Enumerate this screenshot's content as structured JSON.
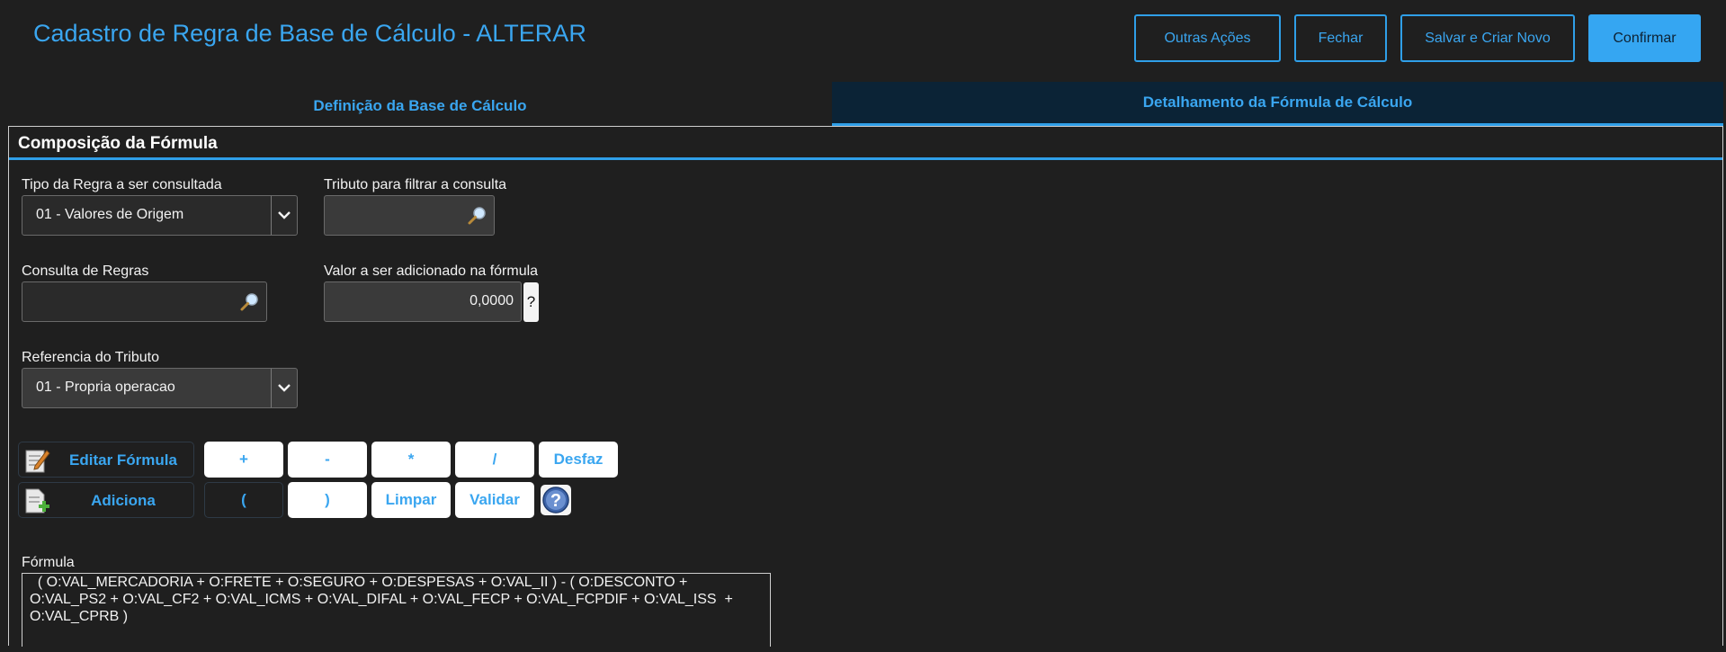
{
  "header": {
    "title": "Cadastro de Regra de Base de Cálculo - ALTERAR",
    "buttons": {
      "outras_acoes": "Outras Ações",
      "fechar": "Fechar",
      "salvar_criar_novo": "Salvar e Criar Novo",
      "confirmar": "Confirmar"
    }
  },
  "tabs": [
    {
      "label": "Definição da Base de Cálculo",
      "active": false
    },
    {
      "label": "Detalhamento da Fórmula de Cálculo",
      "active": true
    }
  ],
  "section": {
    "title": "Composição da Fórmula"
  },
  "form": {
    "tipo_regra": {
      "label": "Tipo da Regra a ser consultada",
      "value": "01 - Valores de Origem"
    },
    "tributo_filtro": {
      "label": "Tributo para filtrar a consulta",
      "value": ""
    },
    "consulta_regras": {
      "label": "Consulta de Regras",
      "value": ""
    },
    "valor_adicionado": {
      "label": "Valor a ser adicionado na fórmula",
      "value": "0,0000",
      "help": "?"
    },
    "referencia_tributo": {
      "label": "Referencia do Tributo",
      "value": "01 - Propria operacao"
    }
  },
  "toolbar": {
    "editar_formula": "Editar Fórmula",
    "adiciona": "Adiciona",
    "ops_row1": [
      "+",
      "-",
      "*",
      "/",
      "Desfaz"
    ],
    "ops_row2": [
      "(",
      ")",
      "Limpar",
      "Validar"
    ]
  },
  "formula": {
    "label": "Fórmula",
    "text": "  ( O:VAL_MERCADORIA + O:FRETE + O:SEGURO + O:DESPESAS + O:VAL_II ) - ( O:DESCONTO +\nO:VAL_PS2 + O:VAL_CF2 + O:VAL_ICMS + O:VAL_DIFAL + O:VAL_FECP + O:VAL_FCPDIF + O:VAL_ISS  +\nO:VAL_CPRB )"
  },
  "icons": [
    "chevron-down-icon",
    "magnifier-icon",
    "edit-formula-icon",
    "add-document-icon",
    "help-circle-icon"
  ],
  "colors": {
    "accent": "#3aa6f0",
    "background": "#1f1f1f",
    "primary_button": "#35a6f2",
    "active_tab": "#0b2336"
  }
}
